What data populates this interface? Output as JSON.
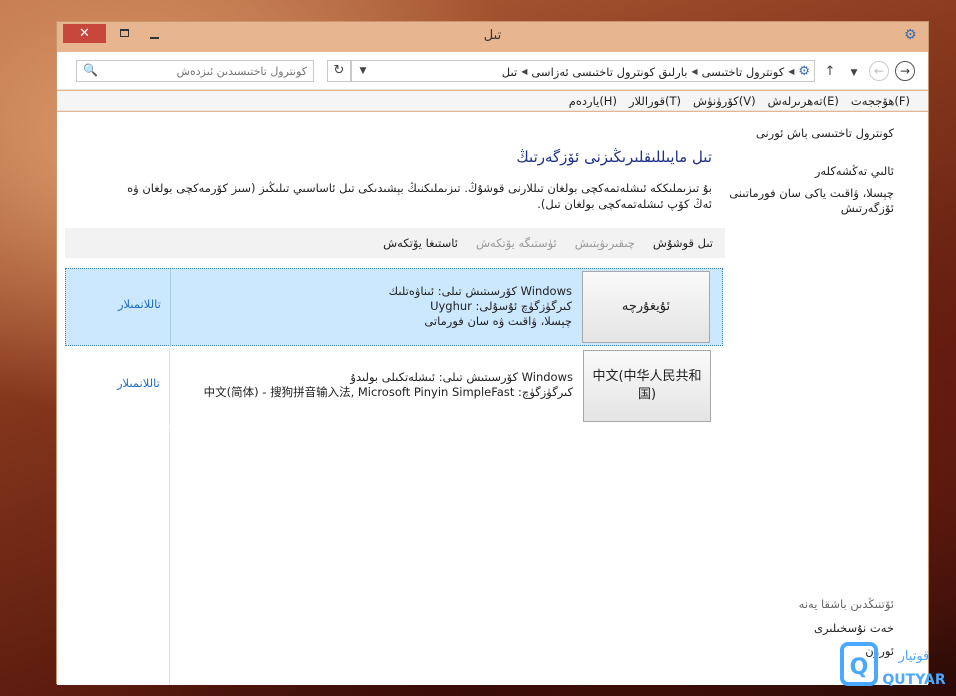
{
  "window": {
    "title": "تىل",
    "close_glyph": "✕"
  },
  "address": {
    "search_placeholder": "كونترول تاختىسىدىن ئىزدەش",
    "breadcrumbs": [
      "كونترول تاختىسى",
      "بارلىق كونترول تاختىسى ئەزاسى",
      "تىل"
    ]
  },
  "menu": {
    "items": [
      "ھۆججەت(F)",
      "تەھرىرلەش(E)",
      "كۆرۈنۈش(V)",
      "قوراللار(T)",
      "ياردەم(H)"
    ]
  },
  "sidebar": {
    "home": "كونترول تاختىسى باش ئورنى",
    "advanced": "ئالىي تەڭشەكلەر",
    "datetime": "چېسلا، ۋاقىت ياكى سان فورماتىنى ئۆزگەرتىش",
    "see_also_heading": "ئۆتنىڭدىن باشقا يەنە",
    "fonts": "خەت نۇسخىلىرى",
    "location": "ئورۇن"
  },
  "main": {
    "title": "تىل مايىللىقلىرىڭىزنى ئۆزگەرتىڭ",
    "description": "بۇ تىزىملىككە ئىشلەتمەكچى بولغان تىللارنى قوشۇڭ. تىزىملىكنىڭ بېشىدىكى تىل ئاساسىي تىلىڭىز (سىز كۆرمەكچى بولغان ۋە ئەڭ كۆپ ئىشلەتمەكچى بولغان تىل)."
  },
  "toolbar": {
    "add": "تىل قوشۇش",
    "remove": "چىقىرىۋېتىش",
    "move_up": "ئۈستىگە يۆتكەش",
    "move_down": "ئاستىغا يۆتكەش"
  },
  "languages": [
    {
      "name": "ئۇيغۇرچە",
      "line1": "Windows كۆرسىتىش تىلى: ئىناۋەتلىك",
      "line2": "كىرگۈزگۈچ ئۇسۇلى: Uyghur",
      "line3": "چېسلا، ۋاقىت ۋە سان فورماتى",
      "options": "تاللانمىلار"
    },
    {
      "name": "中文(中华人民共和国)",
      "line1": "Windows كۆرسىتىش تىلى: ئىشلەتكىلى بولىدۇ",
      "line2": "كىرگۈزگۈچ: 中文(简体) - 搜狗拼音输入法, Microsoft Pinyin SimpleFast",
      "options": "تاللانمىلار"
    }
  ],
  "logo": {
    "text": "QUTYAR",
    "mark": "Q",
    "arabic": "قوتيار"
  },
  "colors": {
    "accent": "#1e3287",
    "link": "#1e6dc4",
    "selection": "#cce8ff",
    "close": "#c7473c"
  }
}
